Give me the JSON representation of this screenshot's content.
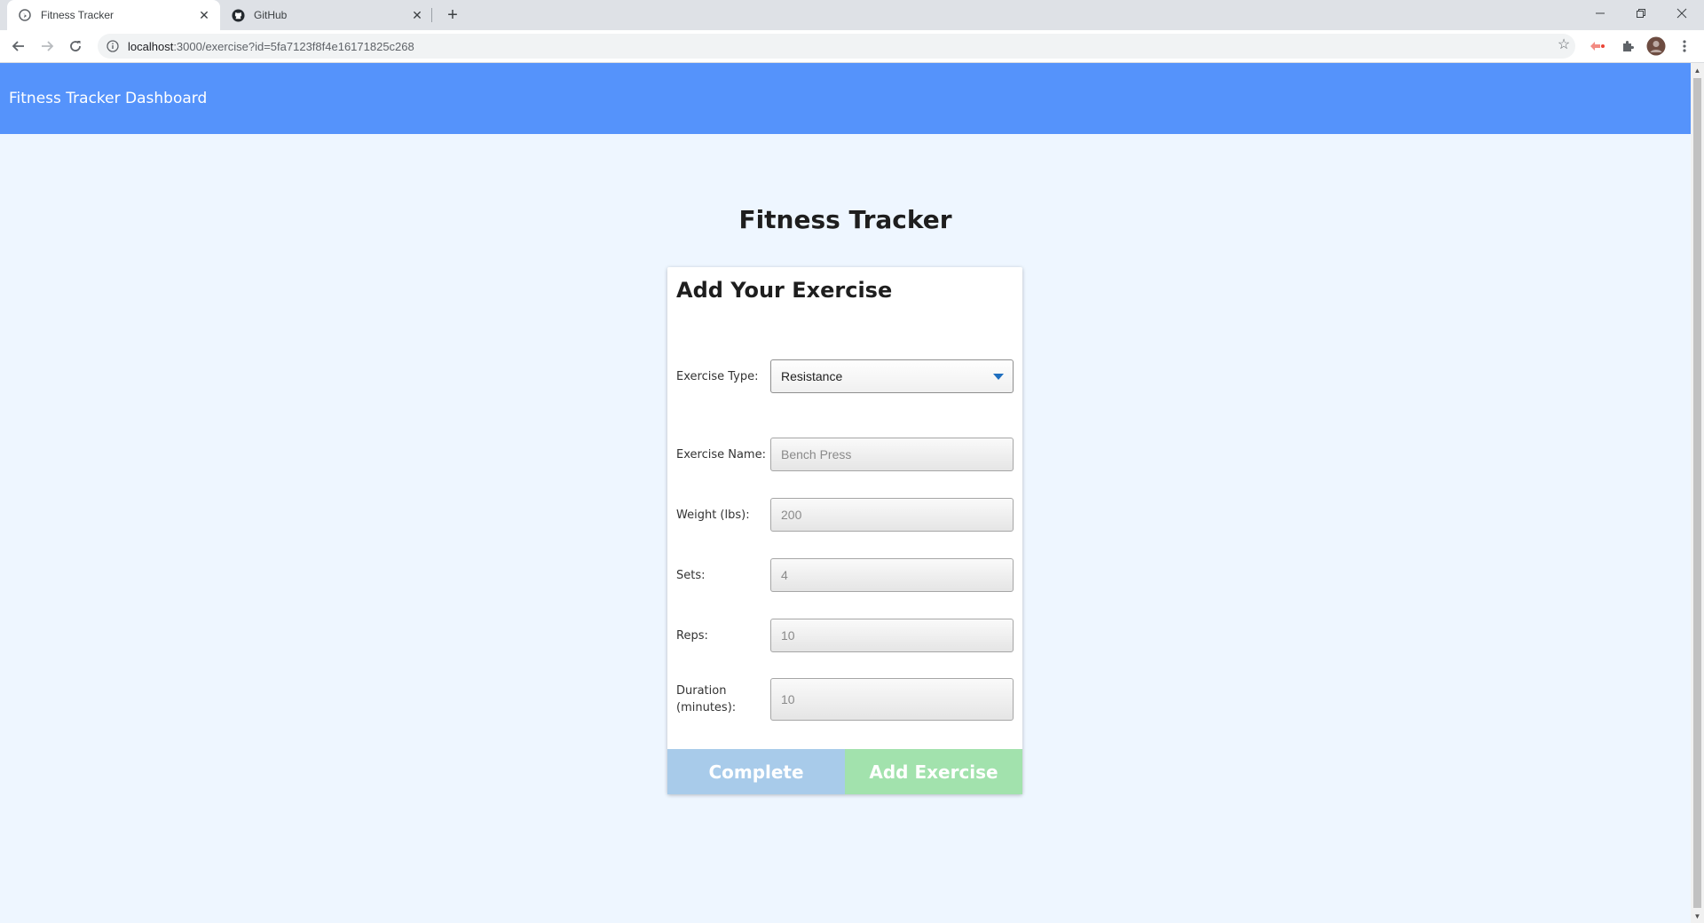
{
  "browser": {
    "tabs": [
      {
        "title": "Fitness Tracker",
        "active": true,
        "icon": "globe-icon"
      },
      {
        "title": "GitHub",
        "active": false,
        "icon": "github-icon"
      }
    ],
    "url_host": "localhost",
    "url_rest": ":3000/exercise?id=5fa7123f8f4e16171825c268"
  },
  "navbar": {
    "brand": "Fitness Tracker Dashboard",
    "color": "#5593fb"
  },
  "page": {
    "title": "Fitness Tracker"
  },
  "form": {
    "heading": "Add Your Exercise",
    "fields": {
      "type": {
        "label": "Exercise Type:",
        "value": "Resistance"
      },
      "name": {
        "label": "Exercise Name:",
        "placeholder": "Bench Press"
      },
      "weight": {
        "label": "Weight (lbs):",
        "placeholder": "200"
      },
      "sets": {
        "label": "Sets:",
        "placeholder": "4"
      },
      "reps": {
        "label": "Reps:",
        "placeholder": "10"
      },
      "duration": {
        "label": "Duration (minutes):",
        "placeholder": "10"
      }
    },
    "buttons": {
      "complete": "Complete",
      "add": "Add Exercise"
    }
  }
}
